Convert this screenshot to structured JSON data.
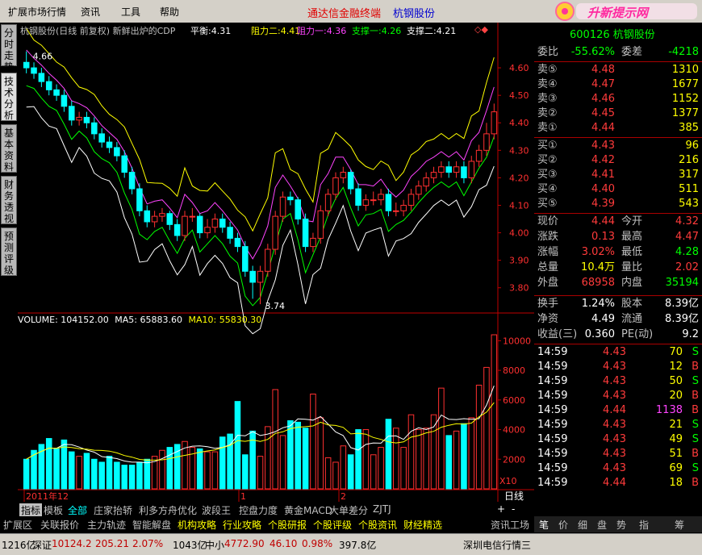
{
  "menu": {
    "items": [
      "扩展市场行情",
      "资讯",
      "工具",
      "帮助"
    ],
    "promo_title": "通达信金融终端",
    "promo_stock": "杭钢股份"
  },
  "brand": {
    "text": "升新提示网",
    "url": "www.hg9s.com"
  },
  "window_code": "600126 杭钢股份",
  "side_tabs": [
    "分时走势",
    "技术分析",
    "基本资料",
    "财务透视",
    "预测评级"
  ],
  "chart_header": {
    "title": "杭钢股份(日线 前复权) 新鲜出炉的CDP",
    "items": [
      {
        "label": "平衡:",
        "value": "4.31",
        "color": "#ffffff"
      },
      {
        "label": "阻力二:",
        "value": "4.41",
        "color": "#ffff00"
      },
      {
        "label": "阻力一:",
        "value": "4.36",
        "color": "#ff44ff"
      },
      {
        "label": "支撑一:",
        "value": "4.26",
        "color": "#00ff00"
      },
      {
        "label": "支撑二:",
        "value": "4.21",
        "color": "#ffffff"
      }
    ]
  },
  "price_axis": {
    "ticks": [
      "4.60",
      "4.50",
      "4.40",
      "4.30",
      "4.20",
      "4.10",
      "4.00",
      "3.90",
      "3.80"
    ],
    "high_label": "4.66",
    "low_label": "3.74"
  },
  "volume_header": {
    "label": "VOLUME:",
    "value": "104152.00",
    "ma5_label": "MA5:",
    "ma5_value": "65883.60",
    "ma10_label": "MA10:",
    "ma10_value": "55830.30"
  },
  "volume_axis": {
    "ticks": [
      "10000",
      "8000",
      "6000",
      "4000",
      "2000"
    ],
    "unit": "X10"
  },
  "date_labels": [
    "2011年12",
    "1",
    "2"
  ],
  "period_label": "日线",
  "chart_data": {
    "type": "candlestick",
    "series_price": {
      "open": [
        4.62,
        4.6,
        4.58,
        4.55,
        4.52,
        4.5,
        4.46,
        4.41,
        4.42,
        4.4,
        4.36,
        4.33,
        4.31,
        4.28,
        4.22,
        4.16,
        4.08,
        4.04,
        4.06,
        4.07,
        4.03,
        3.99,
        4.06,
        4.06,
        4.0,
        4.02,
        4.05,
        4.02,
        3.98,
        3.95,
        3.86,
        3.82,
        3.86,
        3.94,
        4.06,
        4.13,
        4.12,
        4.05,
        3.95,
        3.98,
        4.08,
        4.14,
        4.2,
        4.22,
        4.16,
        4.1,
        4.12,
        4.12,
        4.14,
        4.08,
        4.08,
        4.1,
        4.14,
        4.17,
        4.2,
        4.22,
        4.24,
        4.22,
        4.24,
        4.2,
        4.26,
        4.3,
        4.36
      ],
      "close": [
        4.6,
        4.58,
        4.55,
        4.52,
        4.5,
        4.46,
        4.41,
        4.42,
        4.4,
        4.36,
        4.33,
        4.31,
        4.28,
        4.22,
        4.16,
        4.08,
        4.04,
        4.06,
        4.07,
        4.03,
        3.99,
        4.06,
        4.06,
        4.0,
        4.02,
        4.05,
        4.02,
        3.98,
        3.95,
        3.86,
        3.82,
        3.86,
        3.94,
        4.06,
        4.13,
        4.12,
        4.05,
        3.95,
        3.98,
        4.08,
        4.14,
        4.2,
        4.22,
        4.16,
        4.1,
        4.12,
        4.12,
        4.14,
        4.08,
        4.08,
        4.1,
        4.14,
        4.17,
        4.2,
        4.22,
        4.24,
        4.22,
        4.24,
        4.2,
        4.26,
        4.3,
        4.36,
        4.44
      ],
      "high": [
        4.66,
        4.62,
        4.6,
        4.57,
        4.54,
        4.52,
        4.48,
        4.44,
        4.44,
        4.42,
        4.38,
        4.35,
        4.33,
        4.3,
        4.24,
        4.18,
        4.1,
        4.08,
        4.09,
        4.08,
        4.05,
        4.08,
        4.09,
        4.07,
        4.05,
        4.07,
        4.07,
        4.04,
        4.0,
        3.97,
        3.88,
        3.88,
        3.96,
        4.08,
        4.15,
        4.15,
        4.13,
        4.07,
        4.0,
        4.1,
        4.16,
        4.22,
        4.24,
        4.23,
        4.18,
        4.14,
        4.15,
        4.16,
        4.16,
        4.11,
        4.12,
        4.16,
        4.19,
        4.22,
        4.24,
        4.26,
        4.26,
        4.26,
        4.26,
        4.28,
        4.32,
        4.4,
        4.47
      ],
      "low": [
        4.58,
        4.56,
        4.53,
        4.5,
        4.48,
        4.44,
        4.39,
        4.39,
        4.38,
        4.34,
        4.31,
        4.29,
        4.26,
        4.2,
        4.14,
        4.06,
        4.02,
        4.02,
        4.04,
        4.01,
        3.97,
        3.97,
        4.04,
        3.98,
        3.98,
        4.0,
        4.0,
        3.96,
        3.93,
        3.84,
        3.76,
        3.74,
        3.84,
        3.92,
        4.04,
        4.1,
        4.03,
        3.93,
        3.93,
        3.96,
        4.06,
        4.12,
        4.18,
        4.14,
        4.08,
        4.08,
        4.1,
        4.1,
        4.06,
        4.06,
        4.06,
        4.08,
        4.12,
        4.15,
        4.18,
        4.2,
        4.2,
        4.2,
        4.18,
        4.18,
        4.24,
        4.28,
        4.34
      ]
    },
    "series_volume": [
      2000,
      2600,
      3000,
      3400,
      2700,
      3300,
      2500,
      2200,
      2400,
      2000,
      1800,
      2200,
      1800,
      1600,
      1600,
      1800,
      2000,
      2200,
      2600,
      2800,
      3000,
      3200,
      2800,
      2700,
      2500,
      2500,
      3500,
      3700,
      5900,
      2300,
      3900,
      2200,
      4200,
      6700,
      3600,
      4600,
      4500,
      4100,
      6400,
      4800,
      2100,
      1800,
      2900,
      2300,
      4000,
      4000,
      2300,
      2800,
      4700,
      4100,
      2800,
      5000,
      4000,
      4100,
      5000,
      6800,
      3600,
      3900,
      4400,
      4800,
      7000,
      8200,
      10400
    ],
    "ylim_price": [
      3.72,
      4.7
    ],
    "ylim_volume": [
      0,
      11000
    ]
  },
  "quote": {
    "ratio": {
      "label": "委比",
      "value": "-55.62%",
      "diff_label": "委差",
      "diff": "-4218"
    },
    "sells": [
      {
        "label": "卖⑤",
        "price": "4.48",
        "vol": "1310"
      },
      {
        "label": "卖④",
        "price": "4.47",
        "vol": "1677"
      },
      {
        "label": "卖③",
        "price": "4.46",
        "vol": "1152"
      },
      {
        "label": "卖②",
        "price": "4.45",
        "vol": "1377"
      },
      {
        "label": "卖①",
        "price": "4.44",
        "vol": "385"
      }
    ],
    "buys": [
      {
        "label": "买①",
        "price": "4.43",
        "vol": "96"
      },
      {
        "label": "买②",
        "price": "4.42",
        "vol": "216"
      },
      {
        "label": "买③",
        "price": "4.41",
        "vol": "317"
      },
      {
        "label": "买④",
        "price": "4.40",
        "vol": "511"
      },
      {
        "label": "买⑤",
        "price": "4.39",
        "vol": "543"
      }
    ],
    "stats": [
      {
        "l1": "现价",
        "v1": "4.44",
        "c1": "red",
        "l2": "今开",
        "v2": "4.32",
        "c2": "red"
      },
      {
        "l1": "涨跌",
        "v1": "0.13",
        "c1": "red",
        "l2": "最高",
        "v2": "4.47",
        "c2": "red"
      },
      {
        "l1": "涨幅",
        "v1": "3.02%",
        "c1": "red",
        "l2": "最低",
        "v2": "4.28",
        "c2": "green"
      },
      {
        "l1": "总量",
        "v1": "10.4万",
        "c1": "yellow",
        "l2": "量比",
        "v2": "2.02",
        "c2": "red"
      },
      {
        "l1": "外盘",
        "v1": "68958",
        "c1": "red",
        "l2": "内盘",
        "v2": "35194",
        "c2": "green"
      }
    ],
    "stats2": [
      {
        "l1": "换手",
        "v1": "1.24%",
        "l2": "股本",
        "v2": "8.39亿"
      },
      {
        "l1": "净资",
        "v1": "4.49",
        "l2": "流通",
        "v2": "8.39亿"
      },
      {
        "l1": "收益(三)",
        "v1": "0.360",
        "l2": "PE(动)",
        "v2": "9.2"
      }
    ]
  },
  "ticks": [
    {
      "time": "14:59",
      "price": "4.43",
      "vol": "70",
      "side": "S"
    },
    {
      "time": "14:59",
      "price": "4.43",
      "vol": "12",
      "side": "B"
    },
    {
      "time": "14:59",
      "price": "4.43",
      "vol": "50",
      "side": "S"
    },
    {
      "time": "14:59",
      "price": "4.43",
      "vol": "20",
      "side": "B"
    },
    {
      "time": "14:59",
      "price": "4.44",
      "vol": "1138",
      "side": "B"
    },
    {
      "time": "14:59",
      "price": "4.43",
      "vol": "21",
      "side": "S"
    },
    {
      "time": "14:59",
      "price": "4.43",
      "vol": "49",
      "side": "S"
    },
    {
      "time": "14:59",
      "price": "4.43",
      "vol": "51",
      "side": "B"
    },
    {
      "time": "14:59",
      "price": "4.43",
      "vol": "69",
      "side": "S"
    },
    {
      "time": "14:59",
      "price": "4.44",
      "vol": "18",
      "side": "B"
    }
  ],
  "indicator_tabs": [
    "指标",
    "模板",
    "全部",
    "庄家抬轿",
    "利多方舟优化",
    "波段王",
    "控盘力度",
    "黄金MACD",
    "大单差分",
    "ZJTJ"
  ],
  "nav_tabs": [
    "扩展区",
    "关联报价",
    "主力轨迹",
    "智能解盘",
    "机构攻略",
    "行业攻略",
    "个股研报",
    "个股评级",
    "个股资讯",
    "财经精选",
    "资讯工场"
  ],
  "right_tabs": [
    "笔",
    "价",
    "细",
    "盘",
    "势",
    "指",
    "筹"
  ],
  "zoom_btns": [
    "+",
    "-"
  ],
  "status": [
    {
      "text": "1216亿"
    },
    {
      "label": "深证",
      "value": "10124.2",
      "chg": "205.21",
      "pct": "2.07%",
      "amt": "1043亿"
    },
    {
      "label": "中小",
      "value": "4772.90",
      "chg": "46.10",
      "pct": "0.98%",
      "amt": "397.8亿"
    },
    {
      "text": "深圳电信行情三"
    }
  ]
}
